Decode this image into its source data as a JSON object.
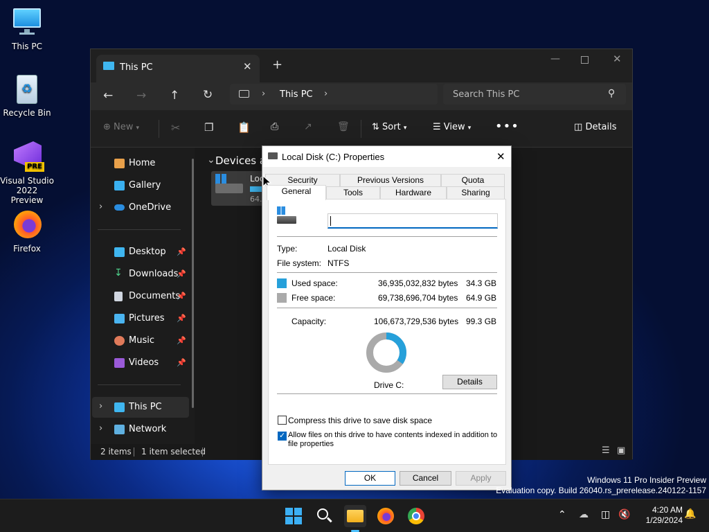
{
  "desktop": {
    "icons": [
      {
        "label": "This PC"
      },
      {
        "label": "Recycle Bin"
      },
      {
        "label": "Visual Studio 2022 Preview"
      },
      {
        "label": "Firefox"
      }
    ],
    "vs_badge": "PRE",
    "watermark": {
      "line1": "Windows 11 Pro Insider Preview",
      "line2": "Evaluation copy. Build 26040.rs_prerelease.240122-1157"
    }
  },
  "explorer": {
    "tab_title": "This PC",
    "breadcrumb": "This PC",
    "search_placeholder": "Search This PC",
    "toolbar": {
      "new_label": "New",
      "sort_label": "Sort",
      "view_label": "View",
      "details_label": "Details"
    },
    "nav": {
      "home": "Home",
      "gallery": "Gallery",
      "onedrive": "OneDrive",
      "desktop": "Desktop",
      "downloads": "Downloads",
      "documents": "Documents",
      "pictures": "Pictures",
      "music": "Music",
      "videos": "Videos",
      "thispc": "This PC",
      "network": "Network"
    },
    "section_header": "Devices ar",
    "drive_name": "Loc",
    "drive_size": "64.",
    "status": {
      "items": "2 items",
      "selected": "1 item selected"
    }
  },
  "dialog": {
    "title": "Local Disk (C:) Properties",
    "tabs_row1": [
      "Security",
      "Previous Versions",
      "Quota"
    ],
    "tabs_row2": [
      "General",
      "Tools",
      "Hardware",
      "Sharing"
    ],
    "active_tab": "General",
    "name_value": "",
    "type_label": "Type:",
    "type_value": "Local Disk",
    "fs_label": "File system:",
    "fs_value": "NTFS",
    "used_label": "Used space:",
    "used_bytes": "36,935,032,832 bytes",
    "used_gb": "34.3 GB",
    "free_label": "Free space:",
    "free_bytes": "69,738,696,704 bytes",
    "free_gb": "64.9 GB",
    "cap_label": "Capacity:",
    "cap_bytes": "106,673,729,536 bytes",
    "cap_gb": "99.3 GB",
    "drive_label": "Drive C:",
    "details_button": "Details",
    "used_fraction": 0.346,
    "used_color": "#26a0da",
    "free_color": "#aaaaaa",
    "compress_label": "Compress this drive to save disk space",
    "compress_checked": false,
    "index_label_line1": "Allow files on this drive to have contents indexed in addition to",
    "index_label_line2": "file properties",
    "index_checked": true,
    "ok": "OK",
    "cancel": "Cancel",
    "apply": "Apply"
  },
  "taskbar": {
    "time": "4:20 AM",
    "date": "1/29/2024"
  }
}
